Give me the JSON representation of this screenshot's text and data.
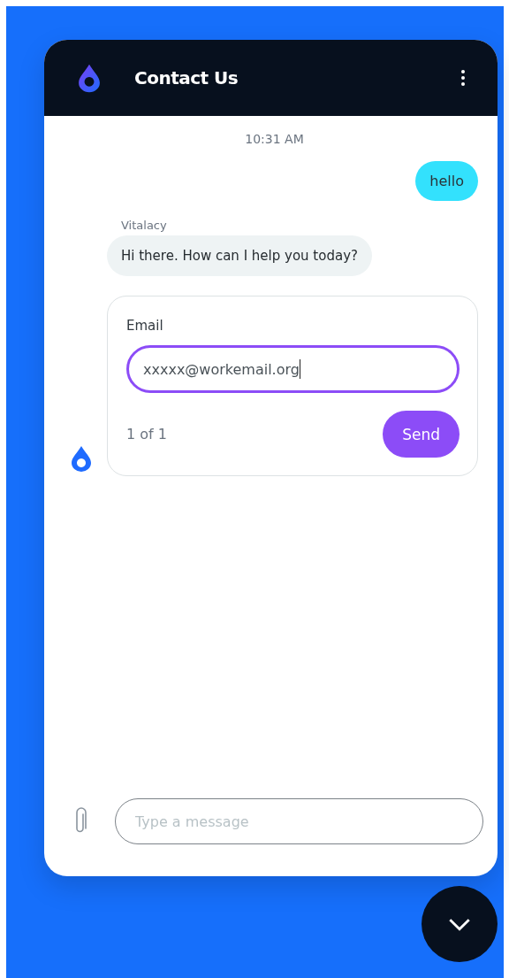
{
  "header": {
    "title": "Contact Us"
  },
  "messages": [
    {
      "kind": "timestamp",
      "text": "10:31 AM"
    },
    {
      "kind": "outgoing",
      "text": "hello"
    },
    {
      "kind": "incoming",
      "sender": "Vitalacy",
      "text": "Hi there. How can I help you today?"
    },
    {
      "kind": "form",
      "label": "Email",
      "value": "xxxxx@workemail.org",
      "pager": "1 of 1",
      "button": "Send"
    }
  ],
  "composer": {
    "placeholder": "Type a message"
  }
}
